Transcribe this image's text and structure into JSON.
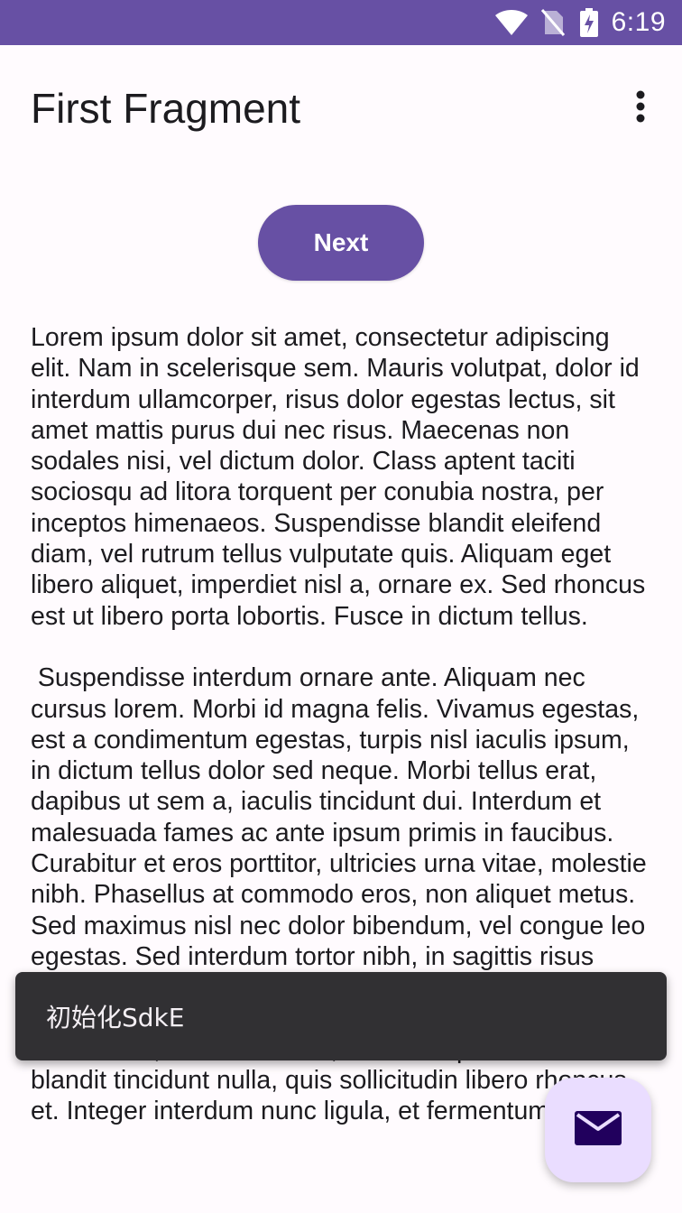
{
  "status_bar": {
    "time": "6:19",
    "icons": [
      "wifi-icon",
      "no-sim-icon",
      "battery-charging-icon"
    ],
    "background": "#6750A4"
  },
  "app_bar": {
    "title": "First Fragment",
    "overflow_icon": "more-vert-icon"
  },
  "main": {
    "next_button_label": "Next",
    "body_text": "Lorem ipsum dolor sit amet, consectetur adipiscing elit. Nam in scelerisque sem. Mauris volutpat, dolor id interdum ullamcorper, risus dolor egestas lectus, sit amet mattis purus dui nec risus. Maecenas non sodales nisi, vel dictum dolor. Class aptent taciti sociosqu ad litora torquent per conubia nostra, per inceptos himenaeos. Suspendisse blandit eleifend diam, vel rutrum tellus vulputate quis. Aliquam eget libero aliquet, imperdiet nisl a, ornare ex. Sed rhoncus est ut libero porta lobortis. Fusce in dictum tellus.\n\n Suspendisse interdum ornare ante. Aliquam nec cursus lorem. Morbi id magna felis. Vivamus egestas, est a condimentum egestas, turpis nisl iaculis ipsum, in dictum tellus dolor sed neque. Morbi tellus erat, dapibus ut sem a, iaculis tincidunt dui. Interdum et malesuada fames ac ante ipsum primis in faucibus. Curabitur et eros porttitor, ultricies urna vitae, molestie nibh. Phasellus at commodo eros, non aliquet metus. Sed maximus nisl nec dolor bibendum, vel congue leo egestas. Sed interdum tortor nibh, in sagittis risus mollis quis. Curabitur mi odio, condimentum sit amet auctor at, mollis non turpis. Nullam pretium libero vestibulum, finibus orci vel, molestie quam. Fusce blandit tincidunt nulla, quis sollicitudin libero rhoncus et. Integer interdum nunc ligula, et fermentum metus"
  },
  "snackbar": {
    "text": "初始化SdkE"
  },
  "fab": {
    "icon": "email-icon",
    "background": "#EADDFF"
  }
}
